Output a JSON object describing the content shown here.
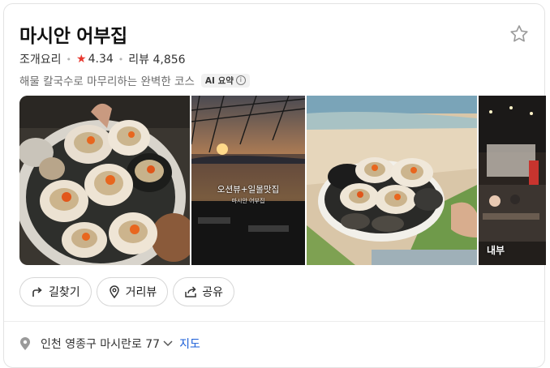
{
  "place": {
    "name": "마시안 어부집",
    "category": "조개요리",
    "rating": "4.34",
    "reviews_label": "리뷰 4,856",
    "summary": "해물 칼국수로 마무리하는 완벽한 코스",
    "ai_tag": "AI 요약",
    "ai_info": "i"
  },
  "photos": {
    "caption_main": "오션뷰+일몰맛집",
    "caption_sub": "마시안 어부집",
    "interior_label": "내부"
  },
  "actions": {
    "directions": "길찾기",
    "streetview": "거리뷰",
    "share": "공유"
  },
  "address": {
    "text": "인천 영종구 마시란로 77",
    "map_link": "지도"
  },
  "colors": {
    "rating_star": "#e8382f",
    "link": "#1a5ed8"
  },
  "icons": {
    "favorite": "star-outline-icon",
    "directions": "directions-arrow-icon",
    "streetview": "location-pin-icon",
    "share": "share-icon",
    "address": "map-pin-icon",
    "expand": "chevron-down-icon"
  }
}
